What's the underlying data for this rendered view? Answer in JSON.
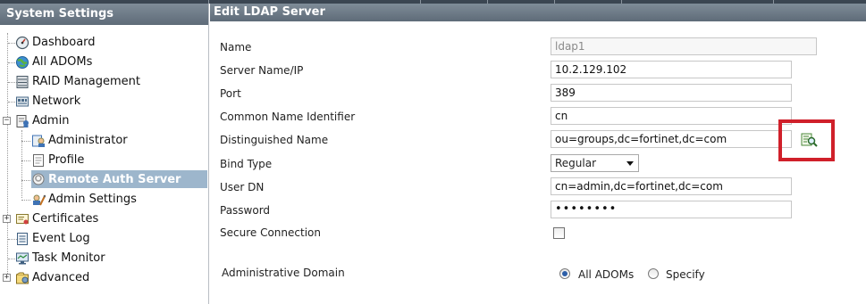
{
  "sidebar": {
    "title": "System Settings",
    "items": [
      {
        "label": "Dashboard",
        "icon": "gauge-icon"
      },
      {
        "label": "All ADOMs",
        "icon": "globe-icon"
      },
      {
        "label": "RAID Management",
        "icon": "raid-icon"
      },
      {
        "label": "Network",
        "icon": "network-icon"
      },
      {
        "label": "Admin",
        "icon": "admin-icon",
        "expanded": true
      },
      {
        "label": "Administrator",
        "icon": "administrator-icon"
      },
      {
        "label": "Profile",
        "icon": "profile-icon"
      },
      {
        "label": "Remote Auth Server",
        "icon": "auth-server-icon",
        "selected": true
      },
      {
        "label": "Admin Settings",
        "icon": "admin-settings-icon"
      },
      {
        "label": "Certificates",
        "icon": "certificate-icon"
      },
      {
        "label": "Event Log",
        "icon": "event-log-icon"
      },
      {
        "label": "Task Monitor",
        "icon": "task-monitor-icon"
      },
      {
        "label": "Advanced",
        "icon": "advanced-icon"
      }
    ]
  },
  "form": {
    "title": "Edit LDAP Server",
    "name_label": "Name",
    "name_value": "ldap1",
    "server_label": "Server Name/IP",
    "server_value": "10.2.129.102",
    "port_label": "Port",
    "port_value": "389",
    "cn_label": "Common Name Identifier",
    "cn_value": "cn",
    "dn_label": "Distinguished Name",
    "dn_value": "ou=groups,dc=fortinet,dc=com",
    "bind_label": "Bind Type",
    "bind_value": "Regular",
    "userdn_label": "User DN",
    "userdn_value": "cn=admin,dc=fortinet,dc=com",
    "password_label": "Password",
    "password_value": "••••••••",
    "secure_label": "Secure Connection",
    "secure_checked": false,
    "domain_label": "Administrative Domain",
    "domain_options": [
      "All ADOMs",
      "Specify"
    ],
    "domain_selected": "All ADOMs",
    "highlight_color": "#d0202a",
    "header_color": "#6e7b88",
    "selected_color": "#9db6cc"
  }
}
